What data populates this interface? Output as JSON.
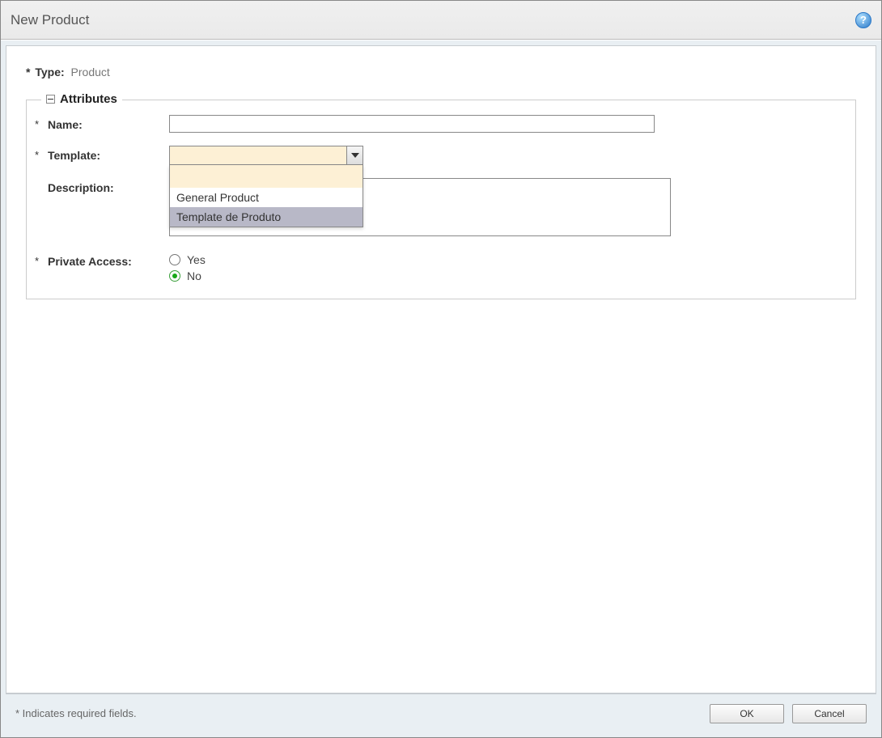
{
  "dialog": {
    "title": "New Product",
    "help_tooltip": "?"
  },
  "type_row": {
    "label": "Type:",
    "value": "Product"
  },
  "fieldset": {
    "legend": "Attributes"
  },
  "fields": {
    "name": {
      "label": "Name:",
      "value": ""
    },
    "template": {
      "label": "Template:",
      "value": "",
      "options": [
        {
          "label": "General Product",
          "selected": false
        },
        {
          "label": "Template de Produto",
          "selected": true
        }
      ]
    },
    "description": {
      "label": "Description:",
      "value": ""
    },
    "private_access": {
      "label": "Private Access:",
      "options": {
        "yes": "Yes",
        "no": "No"
      },
      "selected": "no"
    }
  },
  "footer": {
    "note": "* Indicates required fields.",
    "ok": "OK",
    "cancel": "Cancel"
  }
}
